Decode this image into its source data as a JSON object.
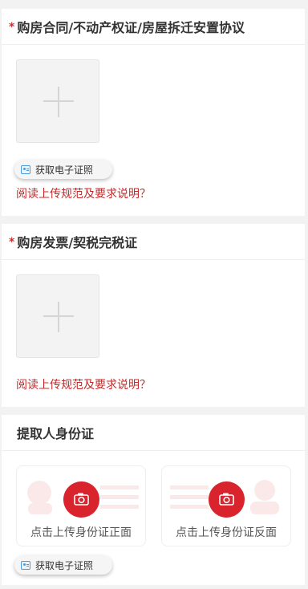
{
  "section1": {
    "required_mark": "*",
    "title": "购房合同/不动产权证/房屋拆迁安置协议",
    "ecert_button": "获取电子证照",
    "guide_link": "阅读上传规范及要求说明？"
  },
  "section2": {
    "required_mark": "*",
    "title": "购房发票/契税完税证",
    "guide_link": "阅读上传规范及要求说明？"
  },
  "section3": {
    "title": "提取人身份证",
    "front_label": "点击上传身份证正面",
    "back_label": "点击上传身份证反面",
    "ecert_button": "获取电子证照"
  },
  "colors": {
    "accent_red": "#d9232d",
    "link_red": "#c62828",
    "page_bg": "#f2f2f2"
  },
  "icons": [
    "plus-icon",
    "id-card-icon",
    "camera-icon"
  ]
}
